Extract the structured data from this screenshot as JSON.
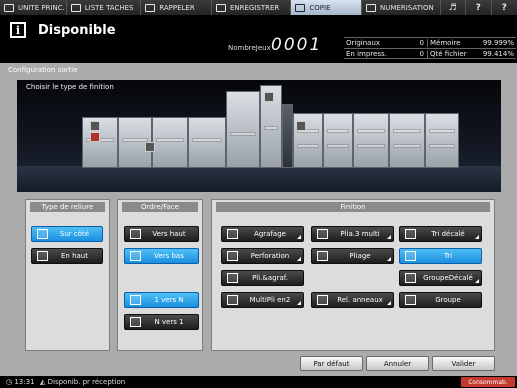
{
  "nav": {
    "tabs": [
      {
        "label": "UNITE PRINC.",
        "icon": "home-icon"
      },
      {
        "label": "LISTE TACHES",
        "icon": "list-icon"
      },
      {
        "label": "RAPPELER",
        "icon": "recall-icon"
      },
      {
        "label": "ENREGISTRER",
        "icon": "save-icon"
      },
      {
        "label": "COPIE",
        "icon": "copy-icon"
      },
      {
        "label": "NUMERISATION",
        "icon": "scan-icon"
      }
    ],
    "volume_icon": "volume-icon",
    "help_label": "?",
    "help2_label": "?"
  },
  "header": {
    "info_label": "i",
    "status": "Disponible",
    "nombre_jeux_label": "NombreJeux",
    "nombre_jeux_value": "0001",
    "table": [
      {
        "label": "Originaux",
        "value": "0",
        "label2": "Mémoire",
        "value2": "99.999%"
      },
      {
        "label": "En impress.",
        "value": "0",
        "label2": "Qté fichier",
        "value2": "99.414%"
      }
    ]
  },
  "main": {
    "section_title": "Configuration sortie",
    "scene_label": "Choisir le type de finition"
  },
  "reliure": {
    "title": "Type de reliure",
    "sur_cote": "Sur côté",
    "en_haut": "En haut",
    "selected": "Sur côté"
  },
  "ordre": {
    "title": "Ordre/Face",
    "vers_haut": "Vers haut",
    "vers_bas": "Vers bas",
    "un_vers_n": "1 vers N",
    "n_vers_un": "N vers 1",
    "selected_face": "Vers bas",
    "selected_order": "1 vers N"
  },
  "finition": {
    "title": "Finition",
    "agrafage": "Agrafage",
    "plia3": "Plia.3 multi",
    "tri_decale": "Tri décalé",
    "perforation": "Perforation",
    "pliage": "Pliage",
    "tri": "Tri",
    "pli_agraf": "Pli.&agraf.",
    "groupe_decale": "GroupeDécalé",
    "multipli": "MultiPli en2",
    "rel_anneaux": "Rel. anneaux",
    "groupe": "Groupe",
    "selected": "Tri"
  },
  "actions": {
    "par_defaut": "Par défaut",
    "annuler": "Annuler",
    "valider": "Valider"
  },
  "statusbar": {
    "time": "13:31",
    "message": "Disponib. pr réception",
    "consumables": "Consommab."
  },
  "colors": {
    "selected": "#1a8ee0",
    "consumables_alert": "#c43a2f"
  }
}
